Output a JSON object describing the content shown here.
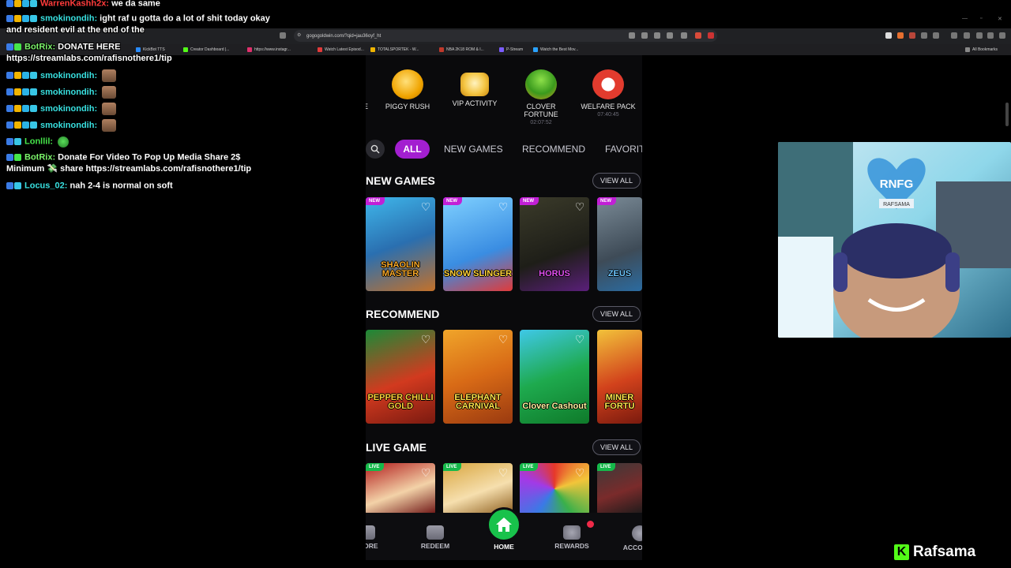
{
  "browser": {
    "url": "gogogoldwin.com/?qid=jau36oyf_ht",
    "bookmarks": [
      {
        "label": "KickBot TTS",
        "color": "#2a8cff"
      },
      {
        "label": "Creator Dashboard |...",
        "color": "#53fc18"
      },
      {
        "label": "https://www.instagr...",
        "color": "#e1306c"
      },
      {
        "label": "Watch Latest Episod...",
        "color": "#e23a3a"
      },
      {
        "label": "TOTALSPORTEK - W...",
        "color": "#f0b400"
      },
      {
        "label": "NBA 2K18 ROM & I...",
        "color": "#c0392b"
      },
      {
        "label": "P-Stream",
        "color": "#7b5cff"
      },
      {
        "label": "Watch the Best Mov...",
        "color": "#2aa2ff"
      }
    ],
    "all_bookmarks": "All Bookmarks"
  },
  "chat": [
    {
      "user": "WarrenKashh2x:",
      "msg": "we da same",
      "user_color": "#ff3b3b"
    },
    {
      "user": "smokinondih:",
      "msg": "ight raf u gotta do a lot of shit today okay",
      "user_color": "#38e0e0"
    },
    {
      "user": "",
      "msg": "and resident evil at the end of the",
      "user_color": "#fff"
    },
    {
      "user": "BotRix:",
      "msg": "DONATE HERE",
      "user_color": "#7cf36b"
    },
    {
      "user": "",
      "msg": "https://streamlabs.com/rafisnothere1/tip",
      "user_color": "#fff"
    },
    {
      "user": "smokinondih:",
      "msg": "",
      "user_color": "#38e0e0"
    },
    {
      "user": "smokinondih:",
      "msg": "",
      "user_color": "#38e0e0"
    },
    {
      "user": "smokinondih:",
      "msg": "",
      "user_color": "#38e0e0"
    },
    {
      "user": "smokinondih:",
      "msg": "",
      "user_color": "#38e0e0"
    },
    {
      "user": "Lonllil:",
      "msg": "",
      "user_color": "#46e64a"
    },
    {
      "user": "BotRix:",
      "msg": "Donate For Video To Pop Up Media Share 2$",
      "user_color": "#7cf36b"
    },
    {
      "user": "",
      "msg": "Minimum 💸 share https://streamlabs.com/rafisnothere1/tip",
      "user_color": "#fff"
    },
    {
      "user": "Locus_02:",
      "msg": "nah 2-4 is normal on soft",
      "user_color": "#38e0e0"
    }
  ],
  "promos": [
    {
      "label": "E",
      "timer": ""
    },
    {
      "label": "PIGGY RUSH",
      "timer": ""
    },
    {
      "label": "VIP ACTIVITY",
      "timer": ""
    },
    {
      "label": "CLOVER FORTUNE",
      "timer": "02:07:52"
    },
    {
      "label": "WELFARE PACK",
      "timer": "07:40:45"
    }
  ],
  "tabs": [
    "ALL",
    "NEW GAMES",
    "RECOMMEND",
    "FAVORIT"
  ],
  "sections": {
    "new_games": {
      "title": "NEW GAMES",
      "view_all": "VIEW ALL"
    },
    "recommend": {
      "title": "RECOMMEND",
      "view_all": "VIEW ALL"
    },
    "live": {
      "title": "LIVE GAME",
      "view_all": "VIEW ALL"
    }
  },
  "new_games": [
    {
      "tag": "NEW",
      "title": "SHAOLIN MASTER"
    },
    {
      "tag": "NEW",
      "title": "SNOW SLINGER"
    },
    {
      "tag": "NEW",
      "title": "HORUS"
    },
    {
      "tag": "NEW",
      "title": "ZEUS"
    }
  ],
  "recommend_games": [
    {
      "title": "PEPPER CHILLI GOLD"
    },
    {
      "title": "ELEPHANT CARNIVAL"
    },
    {
      "title": "Clover Cashout"
    },
    {
      "title": "MINER FORTU"
    }
  ],
  "live_games": [
    {
      "tag": "LIVE"
    },
    {
      "tag": "LIVE"
    },
    {
      "tag": "LIVE"
    },
    {
      "tag": "LIVE"
    }
  ],
  "nav": [
    "STORE",
    "REDEEM",
    "HOME",
    "REWARDS",
    "ACCOUNT"
  ],
  "webcam": {
    "sign": "RAFSAMA",
    "logo": "RNFG"
  },
  "brand": {
    "letter": "K",
    "name": "Rafsama"
  },
  "colors": {
    "accent": "#a31fd0",
    "home": "#18c24b",
    "alert": "#ef2a48",
    "kick": "#53fc18"
  }
}
